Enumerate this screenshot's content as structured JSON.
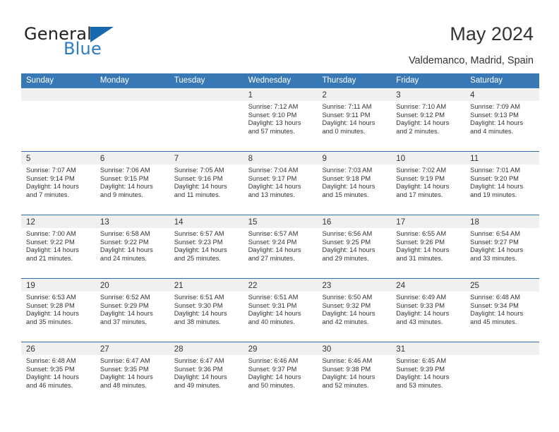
{
  "brand": {
    "name_part1": "General",
    "name_part2": "Blue",
    "triangle_icon": "triangle-logo-icon",
    "accent_color": "#1769ae",
    "blue_text_color": "#2b7cc4"
  },
  "header": {
    "title": "May 2024",
    "subtitle": "Valdemanco, Madrid, Spain"
  },
  "calendar": {
    "header_bg": "#3878b4",
    "day_band_bg": "#f0f0f0",
    "weekdays": [
      "Sunday",
      "Monday",
      "Tuesday",
      "Wednesday",
      "Thursday",
      "Friday",
      "Saturday"
    ],
    "weeks": [
      [
        {
          "day": "",
          "empty": true
        },
        {
          "day": "",
          "empty": true
        },
        {
          "day": "",
          "empty": true
        },
        {
          "day": "1",
          "sunrise": "Sunrise: 7:12 AM",
          "sunset": "Sunset: 9:10 PM",
          "daylight1": "Daylight: 13 hours",
          "daylight2": "and 57 minutes."
        },
        {
          "day": "2",
          "sunrise": "Sunrise: 7:11 AM",
          "sunset": "Sunset: 9:11 PM",
          "daylight1": "Daylight: 14 hours",
          "daylight2": "and 0 minutes."
        },
        {
          "day": "3",
          "sunrise": "Sunrise: 7:10 AM",
          "sunset": "Sunset: 9:12 PM",
          "daylight1": "Daylight: 14 hours",
          "daylight2": "and 2 minutes."
        },
        {
          "day": "4",
          "sunrise": "Sunrise: 7:09 AM",
          "sunset": "Sunset: 9:13 PM",
          "daylight1": "Daylight: 14 hours",
          "daylight2": "and 4 minutes."
        }
      ],
      [
        {
          "day": "5",
          "sunrise": "Sunrise: 7:07 AM",
          "sunset": "Sunset: 9:14 PM",
          "daylight1": "Daylight: 14 hours",
          "daylight2": "and 7 minutes."
        },
        {
          "day": "6",
          "sunrise": "Sunrise: 7:06 AM",
          "sunset": "Sunset: 9:15 PM",
          "daylight1": "Daylight: 14 hours",
          "daylight2": "and 9 minutes."
        },
        {
          "day": "7",
          "sunrise": "Sunrise: 7:05 AM",
          "sunset": "Sunset: 9:16 PM",
          "daylight1": "Daylight: 14 hours",
          "daylight2": "and 11 minutes."
        },
        {
          "day": "8",
          "sunrise": "Sunrise: 7:04 AM",
          "sunset": "Sunset: 9:17 PM",
          "daylight1": "Daylight: 14 hours",
          "daylight2": "and 13 minutes."
        },
        {
          "day": "9",
          "sunrise": "Sunrise: 7:03 AM",
          "sunset": "Sunset: 9:18 PM",
          "daylight1": "Daylight: 14 hours",
          "daylight2": "and 15 minutes."
        },
        {
          "day": "10",
          "sunrise": "Sunrise: 7:02 AM",
          "sunset": "Sunset: 9:19 PM",
          "daylight1": "Daylight: 14 hours",
          "daylight2": "and 17 minutes."
        },
        {
          "day": "11",
          "sunrise": "Sunrise: 7:01 AM",
          "sunset": "Sunset: 9:20 PM",
          "daylight1": "Daylight: 14 hours",
          "daylight2": "and 19 minutes."
        }
      ],
      [
        {
          "day": "12",
          "sunrise": "Sunrise: 7:00 AM",
          "sunset": "Sunset: 9:22 PM",
          "daylight1": "Daylight: 14 hours",
          "daylight2": "and 21 minutes."
        },
        {
          "day": "13",
          "sunrise": "Sunrise: 6:58 AM",
          "sunset": "Sunset: 9:22 PM",
          "daylight1": "Daylight: 14 hours",
          "daylight2": "and 24 minutes."
        },
        {
          "day": "14",
          "sunrise": "Sunrise: 6:57 AM",
          "sunset": "Sunset: 9:23 PM",
          "daylight1": "Daylight: 14 hours",
          "daylight2": "and 25 minutes."
        },
        {
          "day": "15",
          "sunrise": "Sunrise: 6:57 AM",
          "sunset": "Sunset: 9:24 PM",
          "daylight1": "Daylight: 14 hours",
          "daylight2": "and 27 minutes."
        },
        {
          "day": "16",
          "sunrise": "Sunrise: 6:56 AM",
          "sunset": "Sunset: 9:25 PM",
          "daylight1": "Daylight: 14 hours",
          "daylight2": "and 29 minutes."
        },
        {
          "day": "17",
          "sunrise": "Sunrise: 6:55 AM",
          "sunset": "Sunset: 9:26 PM",
          "daylight1": "Daylight: 14 hours",
          "daylight2": "and 31 minutes."
        },
        {
          "day": "18",
          "sunrise": "Sunrise: 6:54 AM",
          "sunset": "Sunset: 9:27 PM",
          "daylight1": "Daylight: 14 hours",
          "daylight2": "and 33 minutes."
        }
      ],
      [
        {
          "day": "19",
          "sunrise": "Sunrise: 6:53 AM",
          "sunset": "Sunset: 9:28 PM",
          "daylight1": "Daylight: 14 hours",
          "daylight2": "and 35 minutes."
        },
        {
          "day": "20",
          "sunrise": "Sunrise: 6:52 AM",
          "sunset": "Sunset: 9:29 PM",
          "daylight1": "Daylight: 14 hours",
          "daylight2": "and 37 minutes."
        },
        {
          "day": "21",
          "sunrise": "Sunrise: 6:51 AM",
          "sunset": "Sunset: 9:30 PM",
          "daylight1": "Daylight: 14 hours",
          "daylight2": "and 38 minutes."
        },
        {
          "day": "22",
          "sunrise": "Sunrise: 6:51 AM",
          "sunset": "Sunset: 9:31 PM",
          "daylight1": "Daylight: 14 hours",
          "daylight2": "and 40 minutes."
        },
        {
          "day": "23",
          "sunrise": "Sunrise: 6:50 AM",
          "sunset": "Sunset: 9:32 PM",
          "daylight1": "Daylight: 14 hours",
          "daylight2": "and 42 minutes."
        },
        {
          "day": "24",
          "sunrise": "Sunrise: 6:49 AM",
          "sunset": "Sunset: 9:33 PM",
          "daylight1": "Daylight: 14 hours",
          "daylight2": "and 43 minutes."
        },
        {
          "day": "25",
          "sunrise": "Sunrise: 6:48 AM",
          "sunset": "Sunset: 9:34 PM",
          "daylight1": "Daylight: 14 hours",
          "daylight2": "and 45 minutes."
        }
      ],
      [
        {
          "day": "26",
          "sunrise": "Sunrise: 6:48 AM",
          "sunset": "Sunset: 9:35 PM",
          "daylight1": "Daylight: 14 hours",
          "daylight2": "and 46 minutes."
        },
        {
          "day": "27",
          "sunrise": "Sunrise: 6:47 AM",
          "sunset": "Sunset: 9:35 PM",
          "daylight1": "Daylight: 14 hours",
          "daylight2": "and 48 minutes."
        },
        {
          "day": "28",
          "sunrise": "Sunrise: 6:47 AM",
          "sunset": "Sunset: 9:36 PM",
          "daylight1": "Daylight: 14 hours",
          "daylight2": "and 49 minutes."
        },
        {
          "day": "29",
          "sunrise": "Sunrise: 6:46 AM",
          "sunset": "Sunset: 9:37 PM",
          "daylight1": "Daylight: 14 hours",
          "daylight2": "and 50 minutes."
        },
        {
          "day": "30",
          "sunrise": "Sunrise: 6:46 AM",
          "sunset": "Sunset: 9:38 PM",
          "daylight1": "Daylight: 14 hours",
          "daylight2": "and 52 minutes."
        },
        {
          "day": "31",
          "sunrise": "Sunrise: 6:45 AM",
          "sunset": "Sunset: 9:39 PM",
          "daylight1": "Daylight: 14 hours",
          "daylight2": "and 53 minutes."
        },
        {
          "day": "",
          "empty": true
        }
      ]
    ]
  }
}
